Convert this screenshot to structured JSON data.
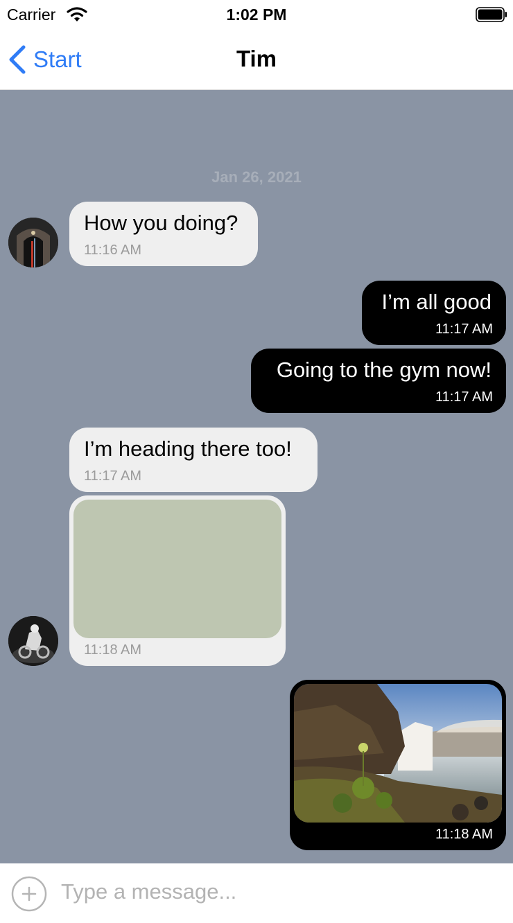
{
  "status_bar": {
    "carrier": "Carrier",
    "time": "1:02 PM"
  },
  "nav": {
    "back_label": "Start",
    "title": "Tim"
  },
  "chat": {
    "date_separator": "Jan 26, 2021",
    "messages": [
      {
        "direction": "in",
        "text": "How you doing?",
        "time": "11:16 AM"
      },
      {
        "direction": "out",
        "text": "I’m all good",
        "time": "11:17 AM"
      },
      {
        "direction": "out",
        "text": "Going to the gym now!",
        "time": "11:17 AM"
      },
      {
        "direction": "in",
        "text": "I’m heading there too!",
        "time": "11:17 AM"
      },
      {
        "direction": "in",
        "type": "image",
        "time": "11:18 AM"
      },
      {
        "direction": "out",
        "type": "image",
        "time": "11:18 AM"
      }
    ]
  },
  "composer": {
    "placeholder": "Type a message..."
  },
  "colors": {
    "accent": "#2f7cf6",
    "chat_background": "#8a94a4",
    "incoming_bubble": "#efefef",
    "outgoing_bubble": "#000000"
  },
  "icons": [
    "wifi-icon",
    "battery-icon",
    "back-chevron-icon",
    "add-circle-icon"
  ]
}
